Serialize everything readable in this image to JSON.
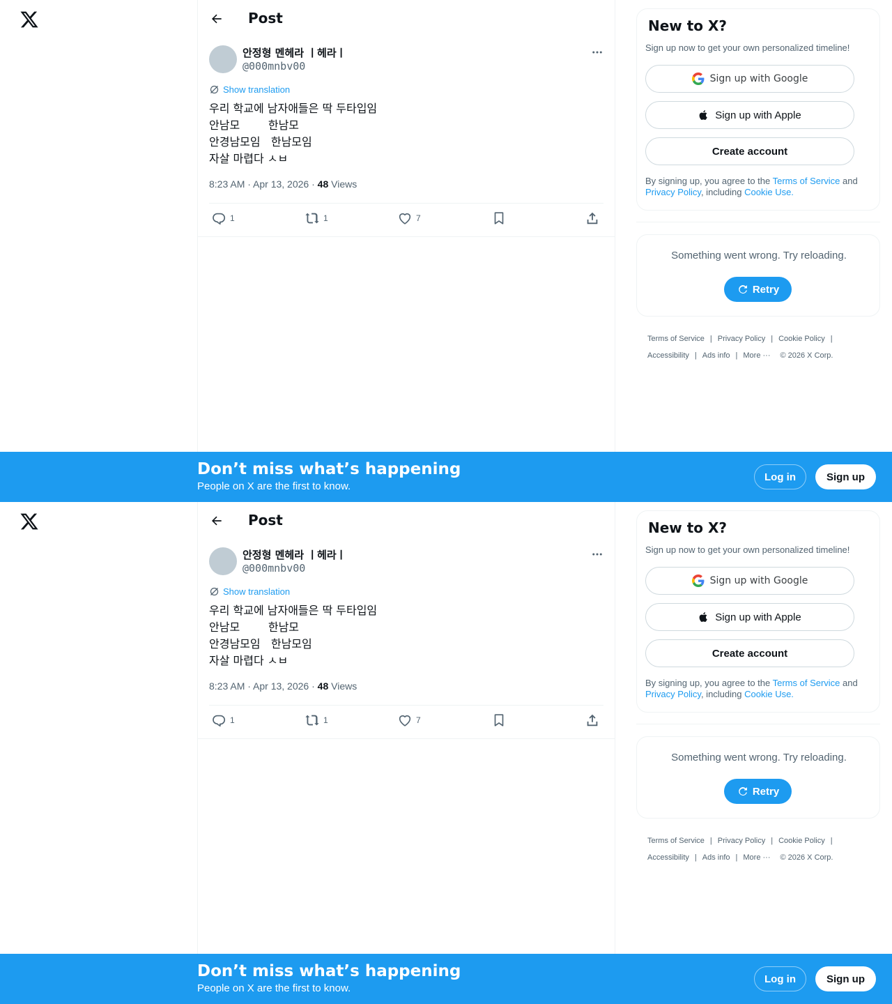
{
  "header": {
    "title": "Post"
  },
  "post": {
    "author_name": "안정형 멘헤라 ㅣ헤라ㅣ",
    "author_handle": "@000mnbv00",
    "show_translation": "Show translation",
    "lines": [
      "우리 학교에 남자애들은 딱 두타입임",
      "안남모        한남모",
      "안경남모임   한남모임",
      "자살 마렵다 ㅅㅂ"
    ],
    "time": "8:23 AM · Apr 13, 2026 · ",
    "views_count": "48",
    "views_label": " Views",
    "replies": "1",
    "reposts": "1",
    "likes": "7"
  },
  "signup": {
    "title": "New to X?",
    "subtitle": "Sign up now to get your own personalized timeline!",
    "google": "Sign up with Google",
    "apple": "Sign up with Apple",
    "create": "Create account",
    "terms_prefix": "By signing up, you agree to the ",
    "terms_of_service": "Terms of Service",
    "terms_and": " and ",
    "privacy_policy": "Privacy Policy",
    "terms_including": ", including ",
    "cookie_use": "Cookie Use."
  },
  "error": {
    "message": "Something went wrong. Try reloading.",
    "retry": "Retry"
  },
  "footer": {
    "terms": "Terms of Service",
    "privacy": "Privacy Policy",
    "cookie": "Cookie Policy",
    "accessibility": "Accessibility",
    "ads": "Ads info",
    "more": "More ···",
    "copyright": "© 2026 X Corp.",
    "separator": "|"
  },
  "banner": {
    "title": "Don’t miss what’s happening",
    "subtitle": "People on X are the first to know.",
    "login": "Log in",
    "signup": "Sign up"
  },
  "colors": {
    "accent": "#1d9bf0",
    "muted": "#536471",
    "text": "#0f1419"
  },
  "icons": [
    "x-logo-icon",
    "back-arrow-icon",
    "more-icon",
    "translate-icon",
    "reply-icon",
    "repost-icon",
    "like-icon",
    "bookmark-icon",
    "share-icon",
    "google-icon",
    "apple-icon",
    "retry-icon"
  ]
}
